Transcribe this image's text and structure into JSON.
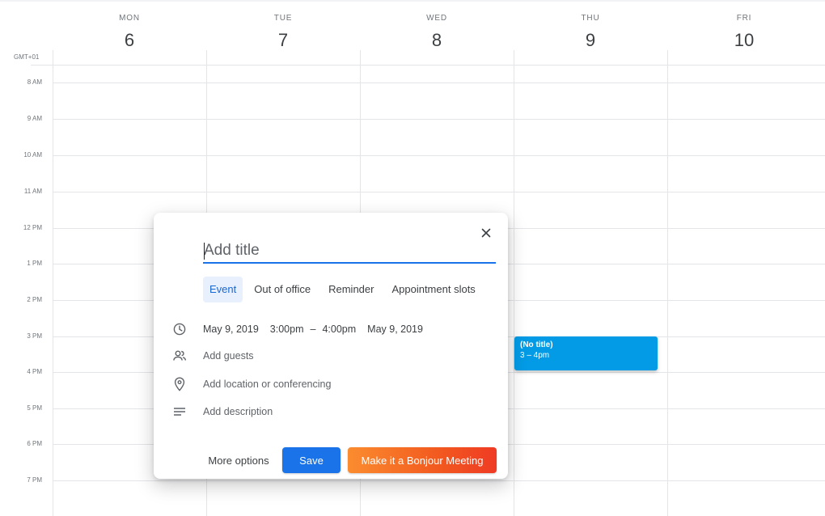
{
  "calendar": {
    "timezone": "GMT+01",
    "days": [
      {
        "name": "MON",
        "number": "6"
      },
      {
        "name": "TUE",
        "number": "7"
      },
      {
        "name": "WED",
        "number": "8"
      },
      {
        "name": "THU",
        "number": "9"
      },
      {
        "name": "FRI",
        "number": "10"
      }
    ],
    "hours": [
      "8 AM",
      "9 AM",
      "10 AM",
      "11 AM",
      "12 PM",
      "1 PM",
      "2 PM",
      "3 PM",
      "4 PM",
      "5 PM",
      "6 PM",
      "7 PM"
    ]
  },
  "event": {
    "title": "(No title)",
    "time": "3 – 4pm",
    "color": "#039be5"
  },
  "dialog": {
    "title_placeholder": "Add title",
    "tabs": [
      {
        "label": "Event",
        "active": true
      },
      {
        "label": "Out of office",
        "active": false
      },
      {
        "label": "Reminder",
        "active": false
      },
      {
        "label": "Appointment slots",
        "active": false
      }
    ],
    "datetime": {
      "start_date": "May 9, 2019",
      "start_time": "3:00pm",
      "separator": "–",
      "end_time": "4:00pm",
      "end_date": "May 9, 2019"
    },
    "guests_placeholder": "Add guests",
    "location_placeholder": "Add location or conferencing",
    "description_placeholder": "Add description",
    "buttons": {
      "more_options": "More options",
      "save": "Save",
      "bonjour": "Make it a Bonjour Meeting"
    },
    "icons": {
      "close": "close-icon",
      "time": "clock-icon",
      "guests": "people-icon",
      "location": "location-pin-icon",
      "description": "description-lines-icon"
    },
    "colors": {
      "accent": "#1a73e8",
      "bonjour_start": "#fb8c2f",
      "bonjour_end": "#ef3b24"
    }
  }
}
